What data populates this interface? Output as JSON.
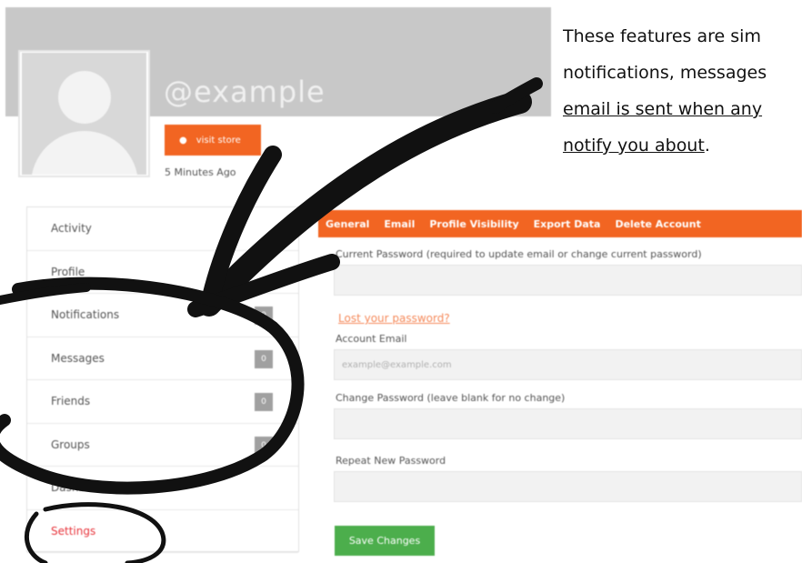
{
  "profile": {
    "username": "@example",
    "visit_store_label": "visit store",
    "last_active": "5 Minutes Ago"
  },
  "sidebar": {
    "items": [
      {
        "label": "Activity",
        "count": ""
      },
      {
        "label": "Profile",
        "count": ""
      },
      {
        "label": "Notifications",
        "count": "0"
      },
      {
        "label": "Messages",
        "count": "0"
      },
      {
        "label": "Friends",
        "count": "0"
      },
      {
        "label": "Groups",
        "count": "0"
      },
      {
        "label": "Dashboard",
        "count": ""
      },
      {
        "label": "Settings",
        "count": ""
      }
    ],
    "active_item": "Settings"
  },
  "settings": {
    "tabs": [
      "General",
      "Email",
      "Profile Visibility",
      "Export Data",
      "Delete Account"
    ],
    "current_tab": "General",
    "current_password_label": "Current Password (required to update email or change current password)",
    "current_password_value": "",
    "lost_password_link": "Lost your password?",
    "account_email_label": "Account Email",
    "account_email_value": "example@example.com",
    "change_password_label": "Change Password (leave blank for no change)",
    "change_password_value": "",
    "repeat_password_label": "Repeat New Password",
    "repeat_password_value": "",
    "save_label": "Save Changes"
  },
  "caption": {
    "line1": "These features are sim",
    "line2": "notifications, messages",
    "line3": "email is sent when any",
    "line4a": "notify you about",
    "line4b": "."
  },
  "colors": {
    "accent": "#f26522",
    "save_button": "#4cae4c",
    "active_menu": "#e8363d",
    "annotation_ink": "#111111"
  }
}
